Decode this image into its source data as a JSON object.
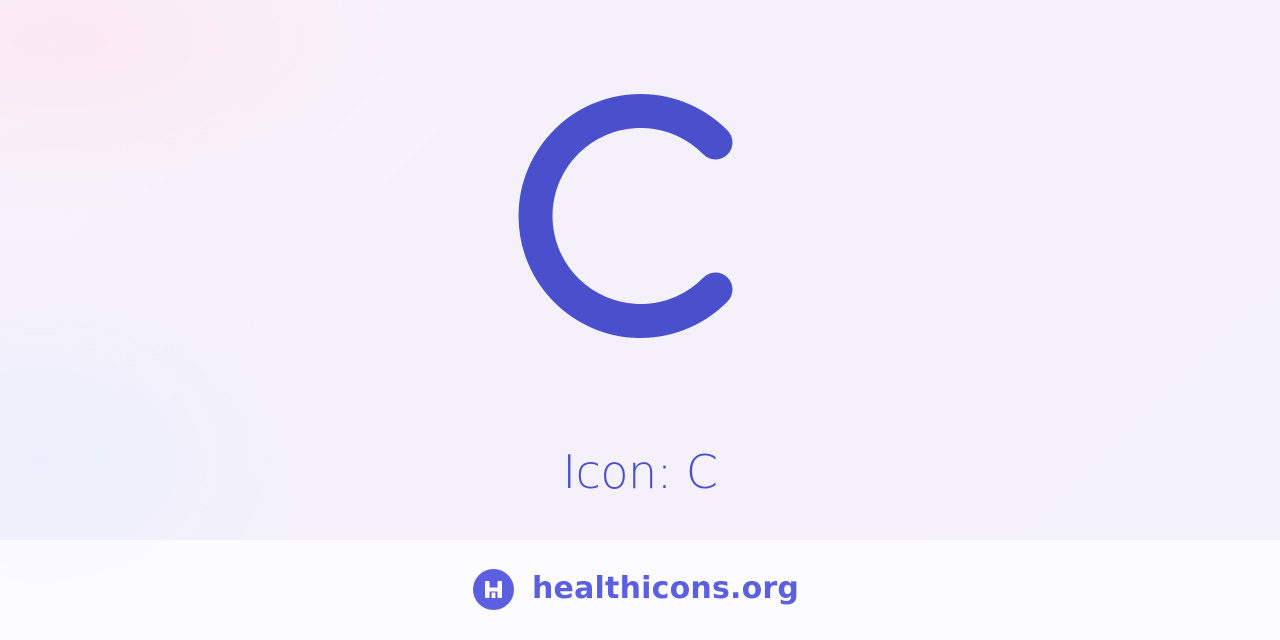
{
  "icon": {
    "name": "c-icon",
    "color": "#4a50cc"
  },
  "title": "Icon: C",
  "footer": {
    "brand_text": "healthicons.org",
    "logo_icon": "healthicons-h-icon",
    "brand_color": "#5b5fe0"
  }
}
